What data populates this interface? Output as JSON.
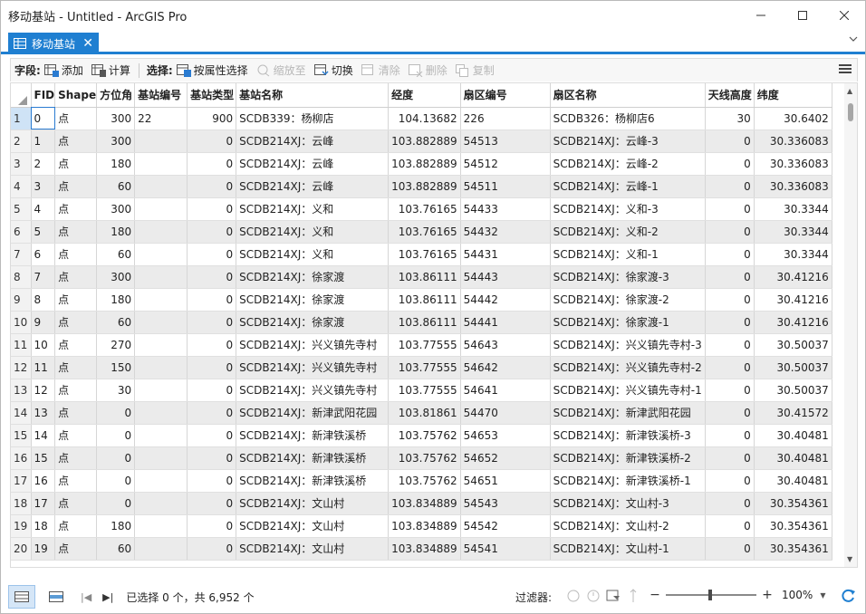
{
  "window": {
    "title": "移动基站 - Untitled - ArcGIS Pro"
  },
  "tab": {
    "label": "移动基站",
    "icon": "table-icon"
  },
  "toolbar": {
    "field_label": "字段:",
    "add_label": "添加",
    "calc_label": "计算",
    "select_label": "选择:",
    "by_attr_label": "按属性选择",
    "zoom_to_label": "缩放至",
    "switch_label": "切换",
    "clear_label": "清除",
    "delete_label": "删除",
    "copy_label": "复制"
  },
  "table": {
    "columns": [
      "FID",
      "Shape",
      "方位角",
      "基站编号",
      "基站类型",
      "基站名称",
      "经度",
      "扇区编号",
      "扇区名称",
      "天线高度",
      "纬度"
    ],
    "rows": [
      [
        "1",
        "0",
        "点",
        "300",
        "22",
        "900",
        "SCDB339：杨柳店",
        "104.13682",
        "226",
        "SCDB326：杨柳店6",
        "30",
        "30.6402"
      ],
      [
        "2",
        "1",
        "点",
        "300",
        "",
        "0",
        "SCDB214XJ：云峰",
        "103.882889",
        "54513",
        "SCDB214XJ：云峰-3",
        "0",
        "30.336083"
      ],
      [
        "3",
        "2",
        "点",
        "180",
        "",
        "0",
        "SCDB214XJ：云峰",
        "103.882889",
        "54512",
        "SCDB214XJ：云峰-2",
        "0",
        "30.336083"
      ],
      [
        "4",
        "3",
        "点",
        "60",
        "",
        "0",
        "SCDB214XJ：云峰",
        "103.882889",
        "54511",
        "SCDB214XJ：云峰-1",
        "0",
        "30.336083"
      ],
      [
        "5",
        "4",
        "点",
        "300",
        "",
        "0",
        "SCDB214XJ：义和",
        "103.76165",
        "54433",
        "SCDB214XJ：义和-3",
        "0",
        "30.3344"
      ],
      [
        "6",
        "5",
        "点",
        "180",
        "",
        "0",
        "SCDB214XJ：义和",
        "103.76165",
        "54432",
        "SCDB214XJ：义和-2",
        "0",
        "30.3344"
      ],
      [
        "7",
        "6",
        "点",
        "60",
        "",
        "0",
        "SCDB214XJ：义和",
        "103.76165",
        "54431",
        "SCDB214XJ：义和-1",
        "0",
        "30.3344"
      ],
      [
        "8",
        "7",
        "点",
        "300",
        "",
        "0",
        "SCDB214XJ：徐家渡",
        "103.86111",
        "54443",
        "SCDB214XJ：徐家渡-3",
        "0",
        "30.41216"
      ],
      [
        "9",
        "8",
        "点",
        "180",
        "",
        "0",
        "SCDB214XJ：徐家渡",
        "103.86111",
        "54442",
        "SCDB214XJ：徐家渡-2",
        "0",
        "30.41216"
      ],
      [
        "10",
        "9",
        "点",
        "60",
        "",
        "0",
        "SCDB214XJ：徐家渡",
        "103.86111",
        "54441",
        "SCDB214XJ：徐家渡-1",
        "0",
        "30.41216"
      ],
      [
        "11",
        "10",
        "点",
        "270",
        "",
        "0",
        "SCDB214XJ：兴义镇先寺村",
        "103.77555",
        "54643",
        "SCDB214XJ：兴义镇先寺村-3",
        "0",
        "30.50037"
      ],
      [
        "12",
        "11",
        "点",
        "150",
        "",
        "0",
        "SCDB214XJ：兴义镇先寺村",
        "103.77555",
        "54642",
        "SCDB214XJ：兴义镇先寺村-2",
        "0",
        "30.50037"
      ],
      [
        "13",
        "12",
        "点",
        "30",
        "",
        "0",
        "SCDB214XJ：兴义镇先寺村",
        "103.77555",
        "54641",
        "SCDB214XJ：兴义镇先寺村-1",
        "0",
        "30.50037"
      ],
      [
        "14",
        "13",
        "点",
        "0",
        "",
        "0",
        "SCDB214XJ：新津武阳花园",
        "103.81861",
        "54470",
        "SCDB214XJ：新津武阳花园",
        "0",
        "30.41572"
      ],
      [
        "15",
        "14",
        "点",
        "0",
        "",
        "0",
        "SCDB214XJ：新津铁溪桥",
        "103.75762",
        "54653",
        "SCDB214XJ：新津铁溪桥-3",
        "0",
        "30.40481"
      ],
      [
        "16",
        "15",
        "点",
        "0",
        "",
        "0",
        "SCDB214XJ：新津铁溪桥",
        "103.75762",
        "54652",
        "SCDB214XJ：新津铁溪桥-2",
        "0",
        "30.40481"
      ],
      [
        "17",
        "16",
        "点",
        "0",
        "",
        "0",
        "SCDB214XJ：新津铁溪桥",
        "103.75762",
        "54651",
        "SCDB214XJ：新津铁溪桥-1",
        "0",
        "30.40481"
      ],
      [
        "18",
        "17",
        "点",
        "0",
        "",
        "0",
        "SCDB214XJ：文山村",
        "103.834889",
        "54543",
        "SCDB214XJ：文山村-3",
        "0",
        "30.354361"
      ],
      [
        "19",
        "18",
        "点",
        "180",
        "",
        "0",
        "SCDB214XJ：文山村",
        "103.834889",
        "54542",
        "SCDB214XJ：文山村-2",
        "0",
        "30.354361"
      ],
      [
        "20",
        "19",
        "点",
        "60",
        "",
        "0",
        "SCDB214XJ：文山村",
        "103.834889",
        "54541",
        "SCDB214XJ：文山村-1",
        "0",
        "30.354361"
      ]
    ]
  },
  "status": {
    "selection_text": "已选择 0 个，共 6,952 个",
    "filter_label": "过滤器:",
    "zoom_pct": "100%",
    "zoom_level": 1.0
  },
  "colors": {
    "accent": "#1f7fd1",
    "alt_row": "#ebebeb"
  }
}
